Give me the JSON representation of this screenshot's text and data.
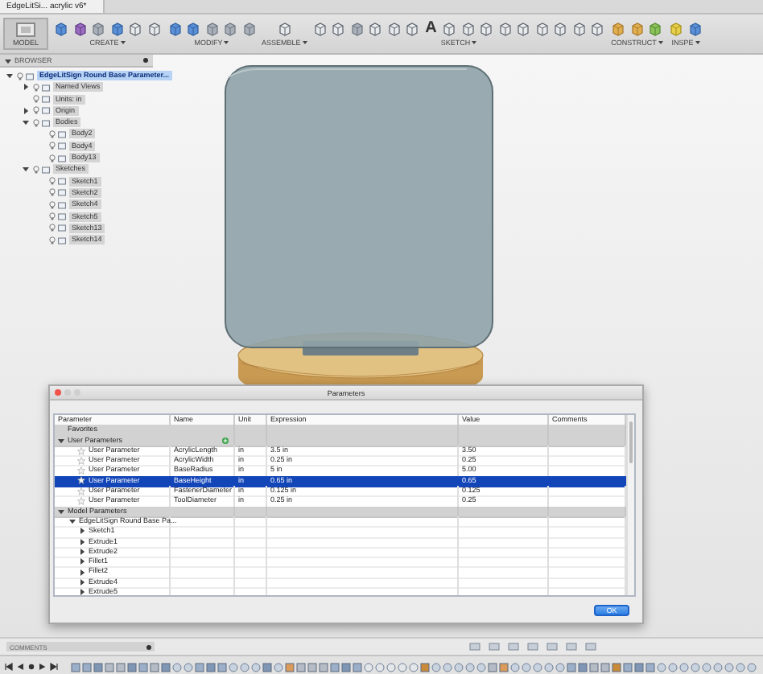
{
  "window": {
    "tab_title": "EdgeLitSi... acrylic v6*"
  },
  "toolbar": {
    "workspace": "MODEL",
    "groups": [
      {
        "label": "CREATE",
        "tools": [
          {
            "kind": "blue"
          },
          {
            "kind": "purple"
          },
          {
            "kind": "grey"
          },
          {
            "kind": "blue"
          },
          {
            "kind": "outline"
          },
          {
            "kind": "outline"
          }
        ]
      },
      {
        "label": "MODIFY",
        "tools": [
          {
            "kind": "blue"
          },
          {
            "kind": "blue"
          },
          {
            "kind": "grey"
          },
          {
            "kind": "grey"
          },
          {
            "kind": "grey"
          }
        ]
      },
      {
        "label": "ASSEMBLE",
        "tools": [
          {
            "kind": "outline"
          }
        ]
      },
      {
        "label": "SKETCH",
        "glyph": "A",
        "tools": [
          {
            "kind": "outline"
          },
          {
            "kind": "outline"
          },
          {
            "kind": "grey"
          },
          {
            "kind": "outline"
          },
          {
            "kind": "outline"
          },
          {
            "kind": "outline"
          },
          {
            "kind": "glyph"
          },
          {
            "kind": "outline"
          },
          {
            "kind": "outline"
          },
          {
            "kind": "outline"
          },
          {
            "kind": "outline"
          },
          {
            "kind": "outline"
          },
          {
            "kind": "outline"
          },
          {
            "kind": "outline"
          },
          {
            "kind": "outline"
          },
          {
            "kind": "outline"
          }
        ]
      },
      {
        "label": "CONSTRUCT",
        "tools": [
          {
            "kind": "orange"
          },
          {
            "kind": "orange"
          },
          {
            "kind": "green"
          }
        ]
      },
      {
        "label": "INSPE",
        "tools": [
          {
            "kind": "yellow"
          },
          {
            "kind": "blue"
          }
        ]
      }
    ]
  },
  "browser": {
    "title": "BROWSER",
    "tree": [
      {
        "label": "EdgeLitSign Round Base Parameter...",
        "expanded": true,
        "selected": true,
        "children": [
          {
            "label": "Named Views",
            "expanded": false,
            "selected": false
          },
          {
            "label": "Units: in",
            "selected": false
          },
          {
            "label": "Origin",
            "expanded": false,
            "selected": false
          },
          {
            "label": "Bodies",
            "expanded": true,
            "selected": false,
            "children": [
              {
                "label": "Body2",
                "selected": false
              },
              {
                "label": "Body4",
                "selected": false
              },
              {
                "label": "Body13",
                "selected": false
              }
            ]
          },
          {
            "label": "Sketches",
            "expanded": true,
            "selected": false,
            "children": [
              {
                "label": "Sketch1",
                "selected": false
              },
              {
                "label": "Sketch2",
                "selected": false
              },
              {
                "label": "Sketch4",
                "selected": false
              },
              {
                "label": "Sketch5",
                "selected": false
              },
              {
                "label": "Sketch13",
                "selected": false
              },
              {
                "label": "Sketch14",
                "selected": false
              }
            ]
          }
        ]
      }
    ]
  },
  "parameters_dialog": {
    "title": "Parameters",
    "columns": [
      "Parameter",
      "Name",
      "Unit",
      "Expression",
      "Value",
      "Comments"
    ],
    "groups": [
      {
        "label": "Favorites"
      },
      {
        "label": "User Parameters",
        "expanded": true,
        "parameters": [
          {
            "parameter": "User Parameter",
            "name": "AcrylicLength",
            "unit": "in",
            "expression": "3.5 in",
            "value": "3.50",
            "selected": false
          },
          {
            "parameter": "User Parameter",
            "name": "AcrylicWidth",
            "unit": "in",
            "expression": "0.25 in",
            "value": "0.25",
            "selected": false
          },
          {
            "parameter": "User Parameter",
            "name": "BaseRadius",
            "unit": "in",
            "expression": "5 in",
            "value": "5.00",
            "selected": false
          },
          {
            "parameter": "User Parameter",
            "name": "BaseHeight",
            "unit": "in",
            "expression": "0.65 in",
            "value": "0.65",
            "selected": true
          },
          {
            "parameter": "User Parameter",
            "name": "FastenerDiameter",
            "unit": "in",
            "expression": "0.125 in",
            "value": "0.125",
            "selected": false
          },
          {
            "parameter": "User Parameter",
            "name": "ToolDiameter",
            "unit": "in",
            "expression": "0.25 in",
            "value": "0.25",
            "selected": false
          }
        ]
      },
      {
        "label": "Model Parameters",
        "expanded": true,
        "children": [
          {
            "label": "EdgeLitSign Round Base Pa...",
            "expanded": true,
            "children": [
              {
                "label": "Sketch1",
                "expanded": false
              },
              {
                "label": "Extrude1",
                "expanded": false
              },
              {
                "label": "Extrude2",
                "expanded": false
              },
              {
                "label": "Fillet1",
                "expanded": false
              },
              {
                "label": "Fillet2",
                "expanded": false
              },
              {
                "label": "Extrude4",
                "expanded": false
              },
              {
                "label": "Extrude5",
                "expanded": false
              }
            ]
          }
        ]
      }
    ],
    "ok_button": "OK"
  },
  "comments": {
    "label": "COMMENTS"
  },
  "timeline": [
    {
      "kind": "sketch"
    },
    {
      "kind": "sketch"
    },
    {
      "kind": "extrude"
    },
    {
      "kind": "fillet"
    },
    {
      "kind": "fillet"
    },
    {
      "kind": "extrude"
    },
    {
      "kind": "sketch"
    },
    {
      "kind": "fillet"
    },
    {
      "kind": "extrude"
    },
    {
      "kind": "move"
    },
    {
      "kind": "move"
    },
    {
      "kind": "sketch"
    },
    {
      "kind": "extrude"
    },
    {
      "kind": "sketch"
    },
    {
      "kind": "move"
    },
    {
      "kind": "move"
    },
    {
      "kind": "move"
    },
    {
      "kind": "extrude"
    },
    {
      "kind": "move"
    },
    {
      "kind": "joint"
    },
    {
      "kind": "fillet"
    },
    {
      "kind": "fillet"
    },
    {
      "kind": "fillet"
    },
    {
      "kind": "sketch"
    },
    {
      "kind": "extrude"
    },
    {
      "kind": "sketch"
    },
    {
      "kind": "body"
    },
    {
      "kind": "body"
    },
    {
      "kind": "body"
    },
    {
      "kind": "body"
    },
    {
      "kind": "body"
    },
    {
      "kind": "axis"
    },
    {
      "kind": "move"
    },
    {
      "kind": "move"
    },
    {
      "kind": "move"
    },
    {
      "kind": "move"
    },
    {
      "kind": "move"
    },
    {
      "kind": "fillet"
    },
    {
      "kind": "joint"
    },
    {
      "kind": "move"
    },
    {
      "kind": "move"
    },
    {
      "kind": "move"
    },
    {
      "kind": "move"
    },
    {
      "kind": "move"
    },
    {
      "kind": "sketch"
    },
    {
      "kind": "extrude"
    },
    {
      "kind": "fillet"
    },
    {
      "kind": "fillet"
    },
    {
      "kind": "axis"
    },
    {
      "kind": "sketch"
    },
    {
      "kind": "extrude"
    },
    {
      "kind": "sketch"
    },
    {
      "kind": "move"
    },
    {
      "kind": "move"
    },
    {
      "kind": "move"
    },
    {
      "kind": "move"
    },
    {
      "kind": "move"
    },
    {
      "kind": "move"
    },
    {
      "kind": "move"
    },
    {
      "kind": "move"
    },
    {
      "kind": "move"
    }
  ]
}
